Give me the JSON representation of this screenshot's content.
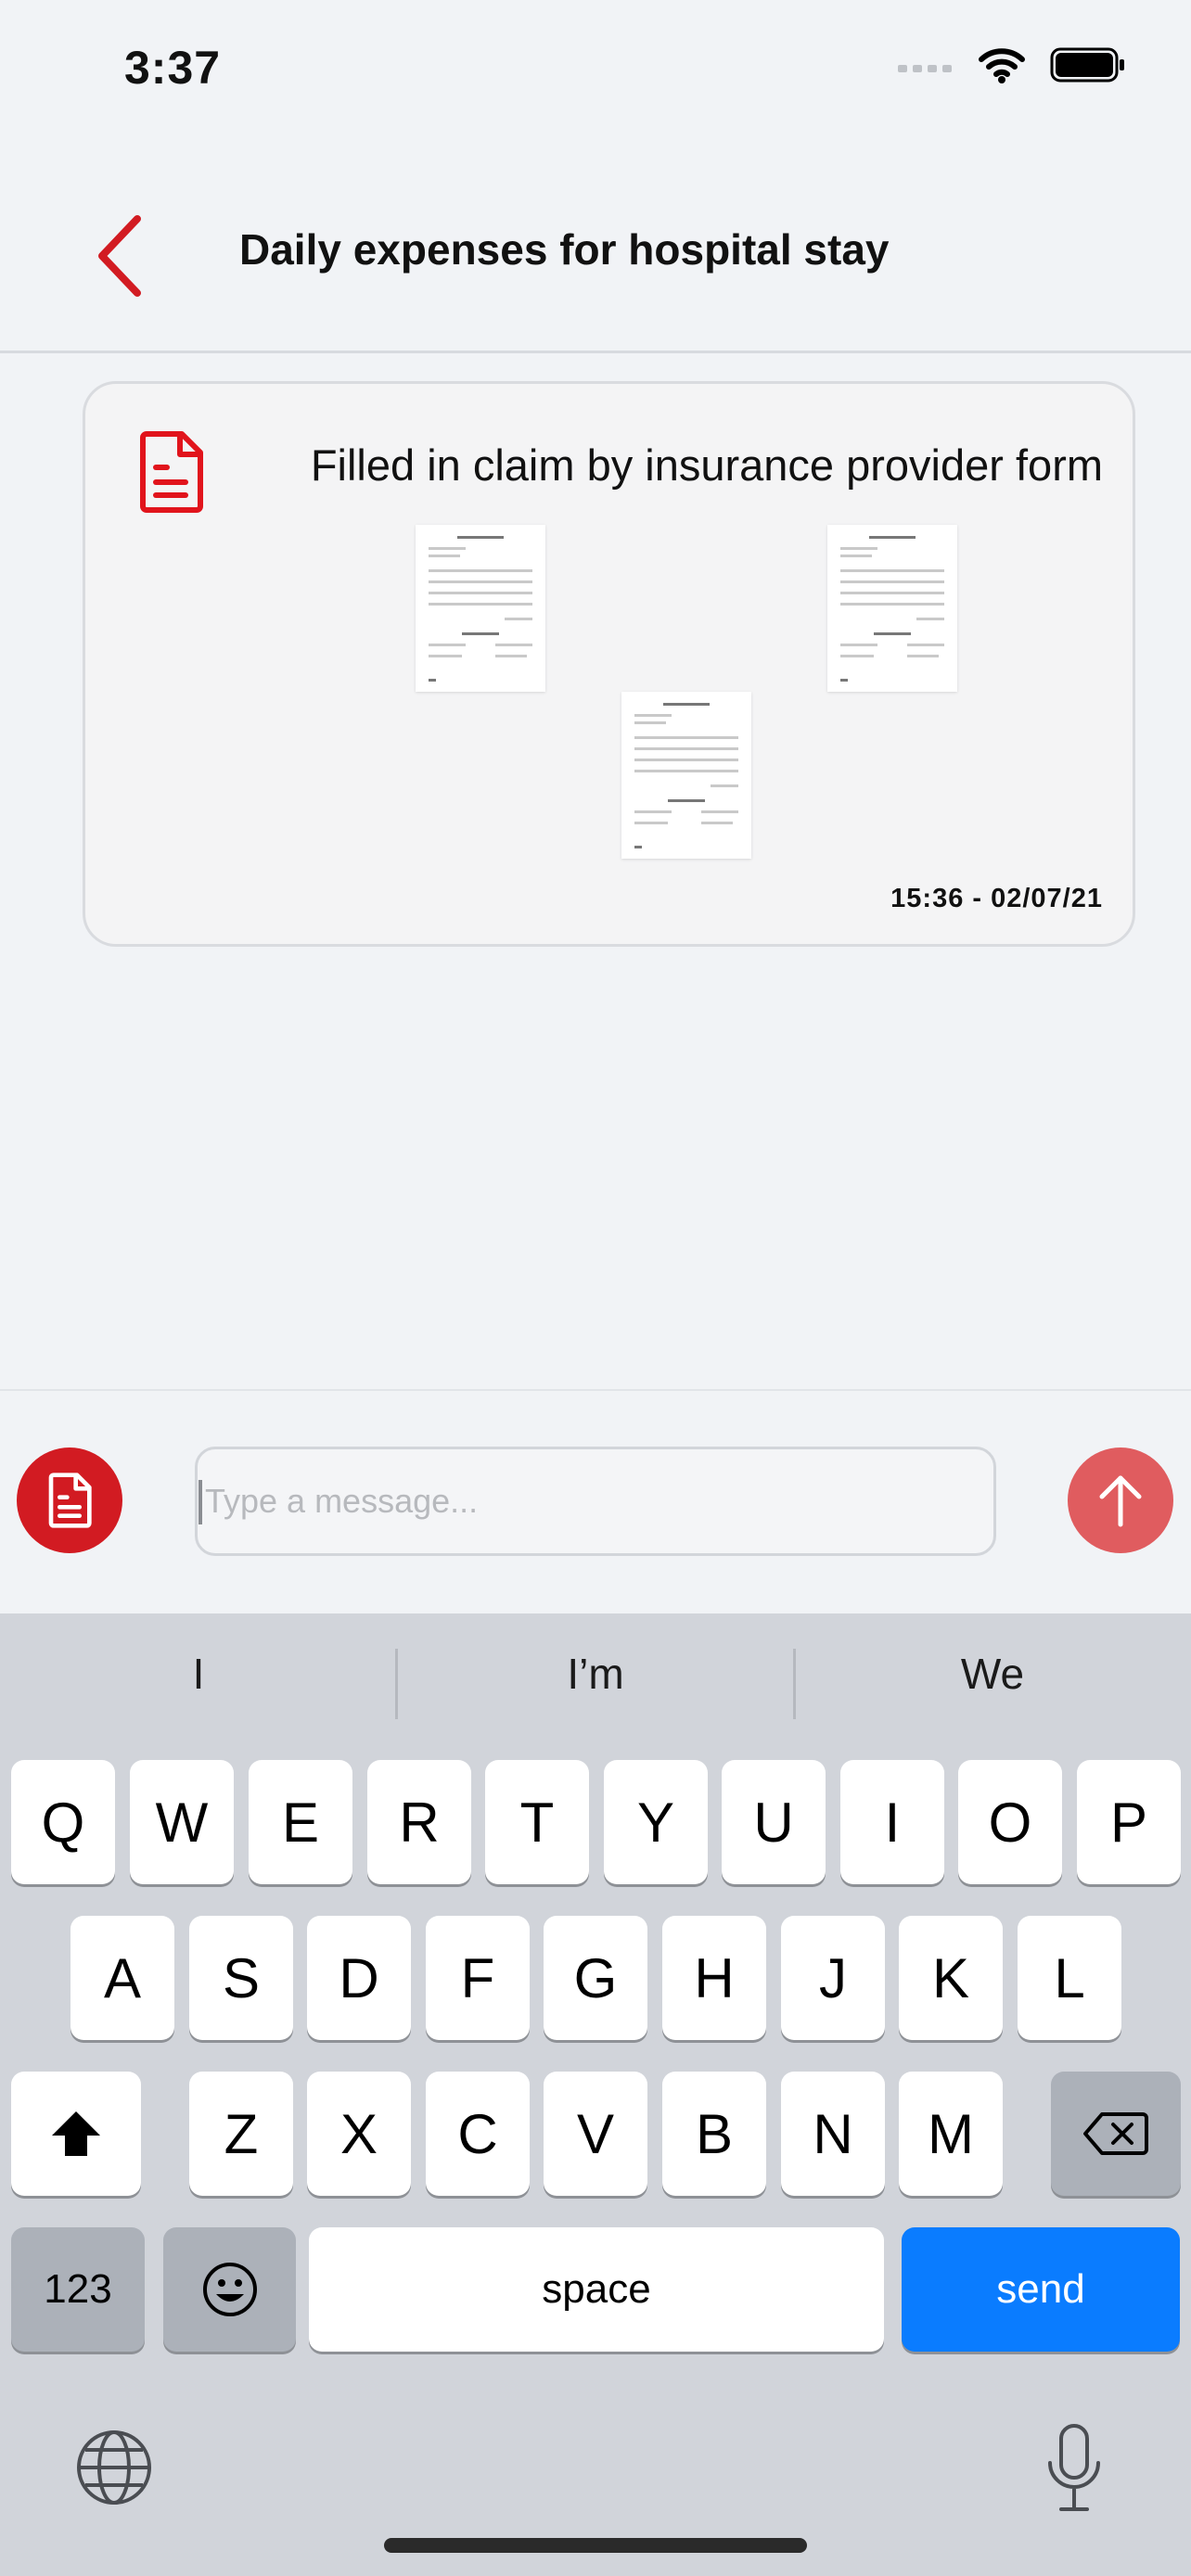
{
  "status_bar": {
    "time": "3:37"
  },
  "header": {
    "title": "Daily expenses for hospital stay"
  },
  "message": {
    "title": "Filled in claim by insurance provider form",
    "timestamp": "15:36 - 02/07/21",
    "attachments": [
      "document-thumbnail",
      "document-thumbnail",
      "document-thumbnail"
    ]
  },
  "composer": {
    "placeholder": "Type a message..."
  },
  "keyboard": {
    "suggestions": [
      "I",
      "I’m",
      "We"
    ],
    "row1": [
      "Q",
      "W",
      "E",
      "R",
      "T",
      "Y",
      "U",
      "I",
      "O",
      "P"
    ],
    "row2": [
      "A",
      "S",
      "D",
      "F",
      "G",
      "H",
      "J",
      "K",
      "L"
    ],
    "row3": [
      "Z",
      "X",
      "C",
      "V",
      "B",
      "N",
      "M"
    ],
    "numbers_label": "123",
    "space_label": "space",
    "send_label": "send"
  },
  "colors": {
    "accent": "#d21b22",
    "send_button": "#e05c5f",
    "keyboard_send": "#0a7cff"
  }
}
